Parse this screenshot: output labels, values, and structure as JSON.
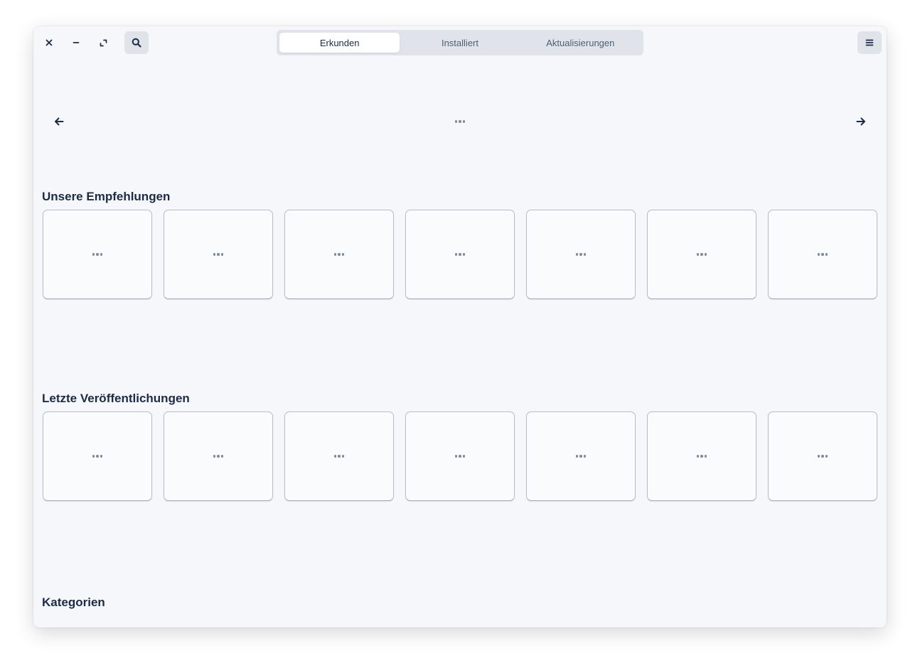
{
  "headerbar": {
    "tabs": [
      {
        "label": "Erkunden",
        "active": true
      },
      {
        "label": "Installiert",
        "active": false
      },
      {
        "label": "Aktualisierungen",
        "active": false
      }
    ]
  },
  "icons": {
    "close": "close-icon",
    "minimize": "minimize-icon",
    "maximize": "maximize-icon",
    "search": "search-icon",
    "menu": "hamburger-menu-icon",
    "carousel_prev": "arrow-left-icon",
    "carousel_next": "arrow-right-icon",
    "loading": "loading-dots-icon"
  },
  "sections": {
    "recommendations": {
      "title": "Unsere Empfehlungen"
    },
    "recent": {
      "title": "Letzte Veröffentlichungen"
    },
    "categories": {
      "title": "Kategorien"
    }
  },
  "colors": {
    "window_bg": "#f5f7fa",
    "text": "#1c2b45",
    "switcher_bg": "#e0e4ea",
    "tile_bg": "#fafbfc",
    "spinner": "#7f8c9d"
  }
}
